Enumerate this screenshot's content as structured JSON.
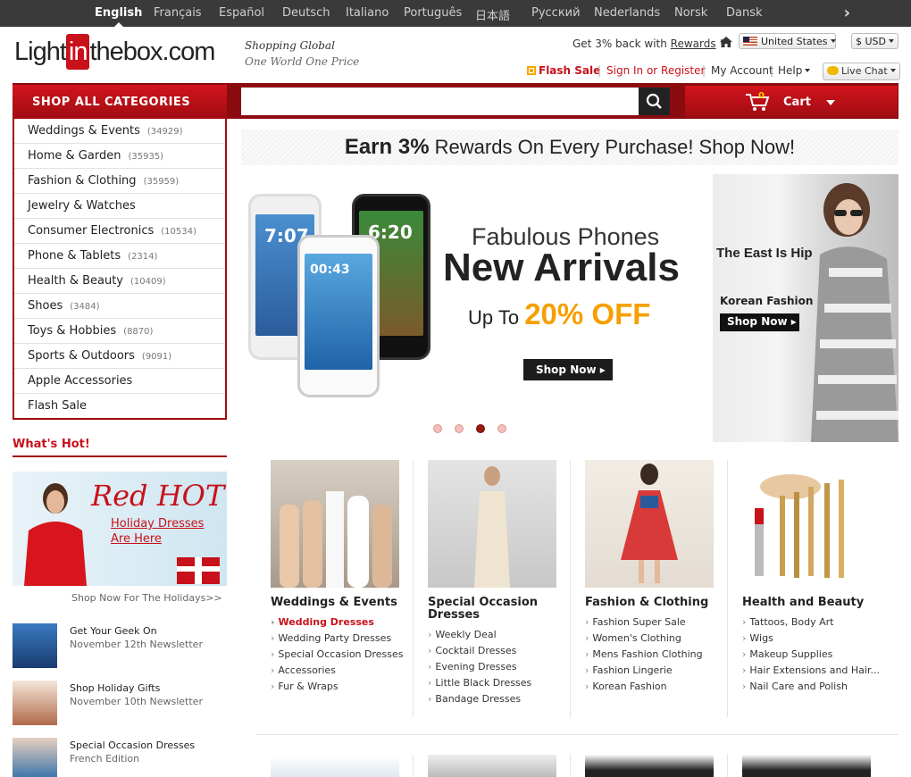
{
  "languages": [
    "English",
    "Français",
    "Español",
    "Deutsch",
    "Italiano",
    "Português",
    "日本語",
    "Русский",
    "Nederlands",
    "Norsk",
    "Dansk"
  ],
  "header": {
    "logo_left": "Light",
    "logo_mid": "in",
    "logo_right": "thebox.com",
    "tagline1": "Shopping Global",
    "tagline2": "One World One Price",
    "rewards_prefix": "Get 3% back with ",
    "rewards_link": "Rewards",
    "rewards_suffix": " !",
    "country": "United States",
    "currency": "$ USD",
    "flash_sale": "Flash Sale",
    "sign_in": "Sign In or Register",
    "my_account": "My Account",
    "help": "Help",
    "live_chat": "Live Chat"
  },
  "nav": {
    "shop_all": "SHOP ALL CATEGORIES",
    "search_placeholder": "",
    "cart_label": "Cart",
    "cart_count": "0"
  },
  "categories": [
    {
      "name": "Weddings & Events",
      "count": "(34929)"
    },
    {
      "name": "Home & Garden",
      "count": "(35935)"
    },
    {
      "name": "Fashion & Clothing",
      "count": "(35959)"
    },
    {
      "name": "Jewelry & Watches",
      "count": ""
    },
    {
      "name": "Consumer Electronics",
      "count": "(10534)"
    },
    {
      "name": "Phone & Tablets",
      "count": "(2314)"
    },
    {
      "name": "Health & Beauty",
      "count": "(10409)"
    },
    {
      "name": "Shoes",
      "count": "(3484)"
    },
    {
      "name": "Toys & Hobbies",
      "count": "(8870)"
    },
    {
      "name": "Sports & Outdoors",
      "count": "(9091)"
    },
    {
      "name": "Apple Accessories",
      "count": ""
    },
    {
      "name": "Flash Sale",
      "count": ""
    }
  ],
  "earn_banner": {
    "bold": "Earn 3%",
    "rest": " Rewards On Every Purchase! Shop Now!"
  },
  "hero": {
    "line1": "Fabulous Phones",
    "line2": "New Arrivals",
    "line3_prefix": "Up To ",
    "line3_pct": "20% OFF",
    "button": "Shop Now ▸",
    "active_slide": 3,
    "slide_count": 4,
    "phone_time_1": "7:07",
    "phone_time_2": "6:20",
    "phone_time_3": "00:43"
  },
  "side_banner": {
    "line1": "The East Is Hip",
    "line2": "Korean Fashion",
    "button": "Shop Now ▸"
  },
  "whats_hot": {
    "title": "What's Hot!",
    "banner_title": "Red HOT",
    "banner_sub1": "Holiday Dresses",
    "banner_sub2": "Are Here",
    "banner_link": "Shop Now For The Holidays>>",
    "news": [
      {
        "title": "Get Your Geek On",
        "sub": "November 12th Newsletter"
      },
      {
        "title": "Shop Holiday Gifts",
        "sub": "November 10th Newsletter"
      },
      {
        "title": "Special Occasion Dresses",
        "sub": "French Edition"
      }
    ]
  },
  "columns": [
    {
      "title": "Weddings & Events",
      "links": [
        "Wedding Dresses",
        "Wedding Party Dresses",
        "Special Occasion Dresses",
        "Accessories",
        "Fur & Wraps"
      ],
      "hot_index": 0
    },
    {
      "title": "Special Occasion Dresses",
      "links": [
        "Weekly Deal",
        "Cocktail Dresses",
        "Evening Dresses",
        "Little Black Dresses",
        "Bandage Dresses"
      ],
      "hot_index": -1
    },
    {
      "title": "Fashion & Clothing",
      "links": [
        "Fashion Super Sale",
        "Women's Clothing",
        "Mens Fashion Clothing",
        "Fashion Lingerie",
        "Korean Fashion"
      ],
      "hot_index": -1
    },
    {
      "title": "Health and Beauty",
      "links": [
        "Tattoos, Body Art",
        "Wigs",
        "Makeup Supplies",
        "Hair Extensions and Hair...",
        "Nail Care and Polish"
      ],
      "hot_index": -1
    }
  ],
  "colors": {
    "brand_red": "#c8111a",
    "dark_red": "#8a0b10",
    "offer_orange": "#f5a000"
  }
}
